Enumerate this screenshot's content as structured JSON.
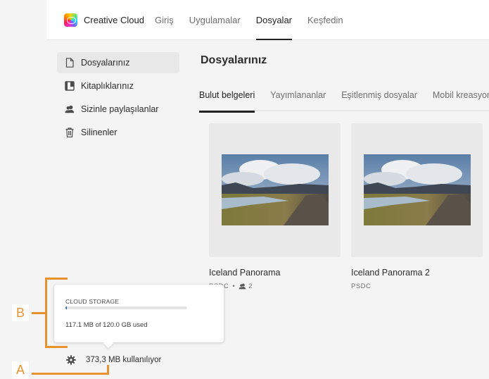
{
  "header": {
    "app_name": "Creative Cloud",
    "logo_icon": "creative-cloud-logo",
    "nav": [
      {
        "label": "Giriş",
        "active": false
      },
      {
        "label": "Uygulamalar",
        "active": false
      },
      {
        "label": "Dosyalar",
        "active": true
      },
      {
        "label": "Keşfedin",
        "active": false
      }
    ]
  },
  "sidebar": {
    "items": [
      {
        "label": "Dosyalarınız",
        "icon": "document-icon",
        "active": true
      },
      {
        "label": "Kitaplıklarınız",
        "icon": "library-icon",
        "active": false
      },
      {
        "label": "Sizinle paylaşılanlar",
        "icon": "users-icon",
        "active": false
      },
      {
        "label": "Silinenler",
        "icon": "trash-icon",
        "active": false
      }
    ]
  },
  "main": {
    "title": "Dosyalarınız",
    "tabs": [
      {
        "label": "Bulut belgeleri",
        "active": true
      },
      {
        "label": "Yayımlananlar",
        "active": false
      },
      {
        "label": "Eşitlenmiş dosyalar",
        "active": false
      },
      {
        "label": "Mobil kreasyonlar",
        "active": false
      }
    ],
    "files": [
      {
        "name": "Iceland Panorama",
        "type": "PSDC",
        "separator": "•",
        "shared_count": "2",
        "shared_icon": "users-icon"
      },
      {
        "name": "Iceland Panorama 2",
        "type": "PSDC"
      }
    ]
  },
  "storage_popover": {
    "heading": "CLOUD STORAGE",
    "used_text": "117.1 MB of 120.0 GB used",
    "used_fraction": 0.001
  },
  "storage_usage": {
    "icon": "gear-icon",
    "label": "373,3 MB kullanılıyor"
  },
  "callouts": {
    "a_label": "A",
    "b_label": "B",
    "color": "#e8922f"
  }
}
